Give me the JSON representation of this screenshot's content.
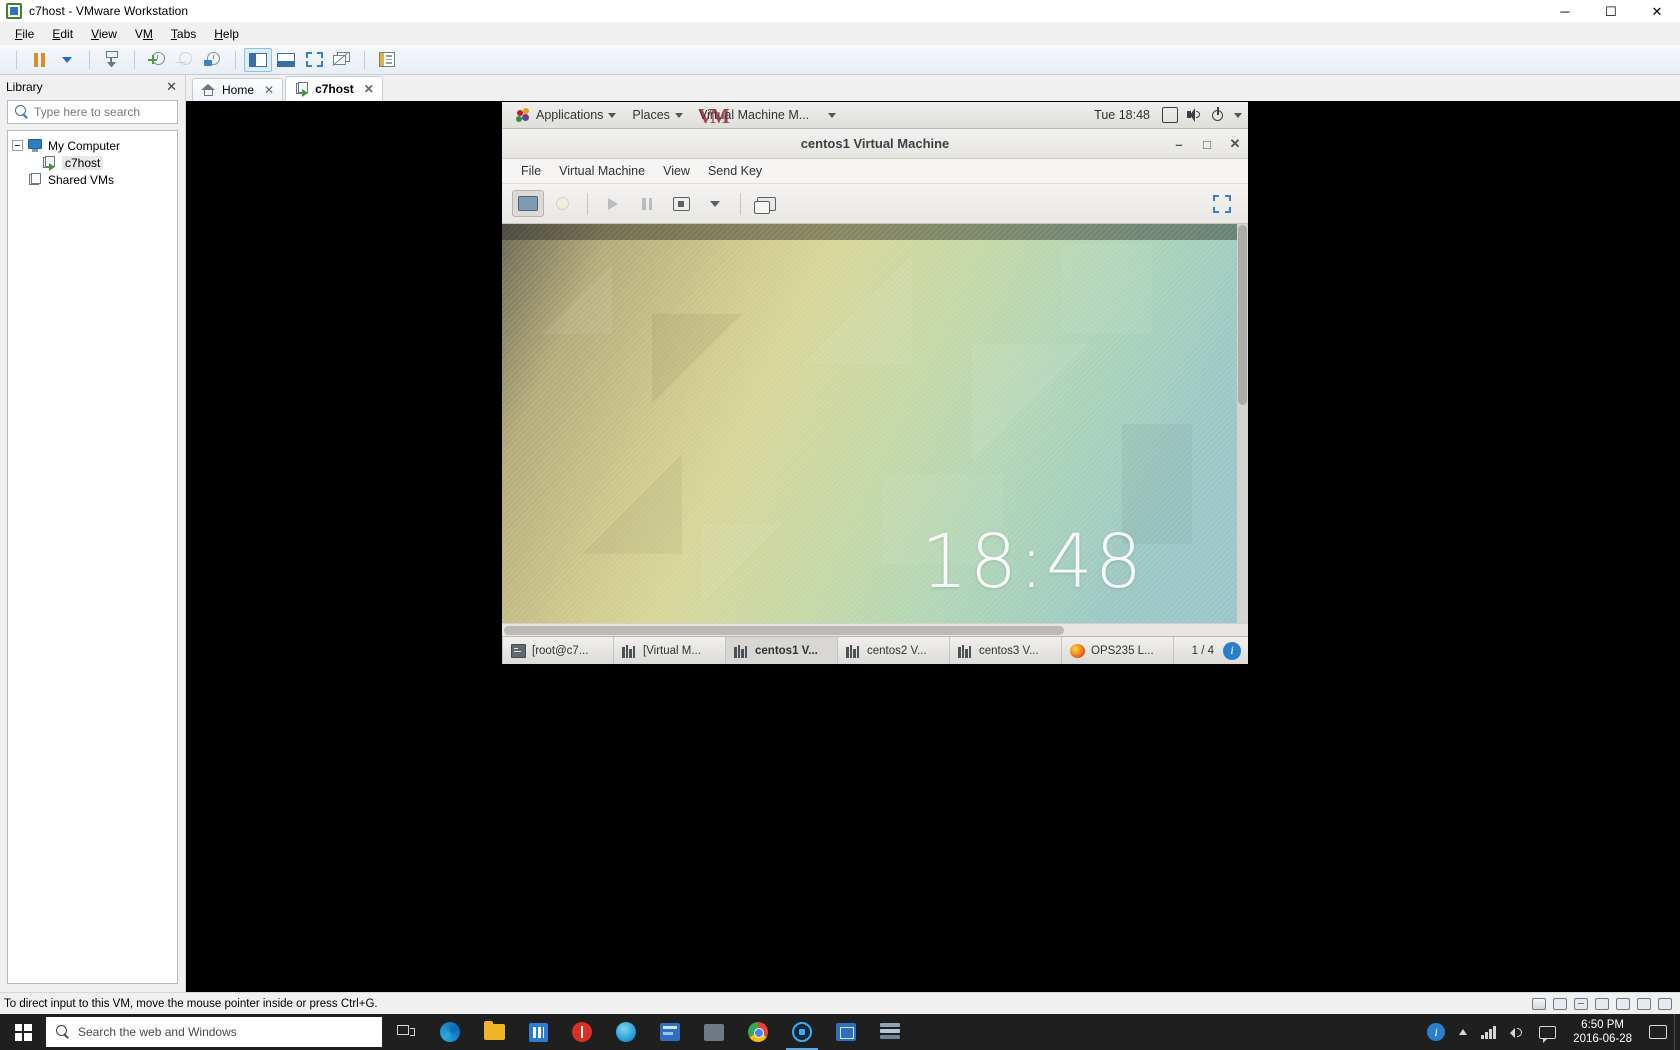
{
  "window": {
    "title": "c7host - VMware Workstation",
    "app_icon": "vmware-icon",
    "minimize": "─",
    "maximize": "☐",
    "close": "✕"
  },
  "menubar": [
    {
      "label": "File",
      "accel": "F"
    },
    {
      "label": "Edit",
      "accel": "E"
    },
    {
      "label": "View",
      "accel": "V"
    },
    {
      "label": "VM",
      "accel": "V"
    },
    {
      "label": "Tabs",
      "accel": "T"
    },
    {
      "label": "Help",
      "accel": "H"
    }
  ],
  "toolbar": {
    "buttons": [
      {
        "name": "suspend-button",
        "icon": "pause-icon"
      },
      {
        "name": "power-dropdown-button",
        "icon": "chevron-down-icon"
      },
      {
        "name": "manage-snapshots-button",
        "icon": "snapshot-manager-icon"
      },
      {
        "name": "take-snapshot-button",
        "icon": "snapshot-add-icon"
      },
      {
        "name": "revert-snapshot-button",
        "icon": "snapshot-revert-icon"
      },
      {
        "name": "snapshot-manager-button",
        "icon": "snapshot-settings-icon"
      },
      {
        "name": "show-library-button",
        "icon": "sidebar-icon"
      },
      {
        "name": "show-thumbnail-bar-button",
        "icon": "thumbnail-bar-icon"
      },
      {
        "name": "enter-fullscreen-button",
        "icon": "fullscreen-icon"
      },
      {
        "name": "unity-mode-button",
        "icon": "unity-icon"
      },
      {
        "name": "show-console-view-button",
        "icon": "console-view-icon"
      }
    ]
  },
  "library": {
    "title": "Library",
    "close_label": "✕",
    "search_placeholder": "Type here to search",
    "search_value": "",
    "tree": [
      {
        "label": "My Computer",
        "icon": "monitor-icon",
        "level": 0,
        "expanded": true,
        "selected": false
      },
      {
        "label": "c7host",
        "icon": "virtual-machine-icon",
        "level": 1,
        "expanded": false,
        "selected": true
      },
      {
        "label": "Shared VMs",
        "icon": "shared-vms-icon",
        "level": 0,
        "expanded": false,
        "selected": false
      }
    ]
  },
  "tabs": [
    {
      "label": "Home",
      "icon": "home-icon",
      "active": false,
      "close": "✕"
    },
    {
      "label": "c7host",
      "icon": "virtual-machine-icon",
      "active": true,
      "close": "✕"
    }
  ],
  "guest": {
    "gnome_panel": {
      "applications": "Applications",
      "places": "Places",
      "active_app": "Virtual Machine M...",
      "clock": "Tue 18:48",
      "tray": [
        "display-icon",
        "volume-icon",
        "power-icon",
        "chevron-down-icon"
      ],
      "overlay_logo": "VM"
    },
    "virt_manager": {
      "window_title": "centos1 Virtual Machine",
      "window_buttons": {
        "minimize": "–",
        "maximize": "□",
        "close": "✕"
      },
      "menus": [
        "File",
        "Virtual Machine",
        "View",
        "Send Key"
      ],
      "toolbar": [
        {
          "name": "show-console-button",
          "icon": "console-icon",
          "state": "active"
        },
        {
          "name": "show-details-button",
          "icon": "lightbulb-icon",
          "state": "dim"
        },
        {
          "name": "run-button",
          "icon": "play-icon",
          "state": "dim"
        },
        {
          "name": "pause-button",
          "icon": "pause-icon",
          "state": "dim"
        },
        {
          "name": "shutdown-button",
          "icon": "stop-icon",
          "state": "normal"
        },
        {
          "name": "shutdown-dropdown-button",
          "icon": "chevron-down-icon",
          "state": "normal"
        },
        {
          "name": "snapshots-button",
          "icon": "snapshots-icon",
          "state": "normal"
        },
        {
          "name": "fullscreen-button",
          "icon": "fullscreen-icon",
          "state": "normal"
        }
      ]
    },
    "desktop": {
      "clock": "18:48"
    },
    "taskbar": {
      "items": [
        {
          "label": "[root@c7...",
          "icon": "terminal-icon",
          "active": false
        },
        {
          "label": "[Virtual M...",
          "icon": "virt-manager-icon",
          "active": false
        },
        {
          "label": "centos1 V...",
          "icon": "virt-manager-icon",
          "active": true
        },
        {
          "label": "centos2 V...",
          "icon": "virt-manager-icon",
          "active": false
        },
        {
          "label": "centos3 V...",
          "icon": "virt-manager-icon",
          "active": false
        },
        {
          "label": "OPS235 L...",
          "icon": "firefox-icon",
          "active": false
        }
      ],
      "workspace": "1 / 4",
      "info_icon": "info-icon"
    }
  },
  "statusbar": {
    "message": "To direct input to this VM, move the mouse pointer inside or press Ctrl+G.",
    "device_icons": [
      "hard-disk-icon",
      "cd-drive-icon",
      "network-icon",
      "sound-icon",
      "usb-icon",
      "printer-icon",
      "display-icon"
    ]
  },
  "windows_taskbar": {
    "start_label": "Start",
    "search_placeholder": "Search the web and Windows",
    "task_view": "task-view-icon",
    "pinned": [
      {
        "name": "edge-icon"
      },
      {
        "name": "file-explorer-icon"
      },
      {
        "name": "microsoft-store-icon"
      },
      {
        "name": "opera-icon"
      },
      {
        "name": "teal-app-icon"
      },
      {
        "name": "blue-app-icon"
      },
      {
        "name": "gray-app-icon"
      },
      {
        "name": "chrome-icon"
      },
      {
        "name": "vmware-workstation-icon"
      },
      {
        "name": "vmware-player-icon"
      },
      {
        "name": "stack-app-icon"
      }
    ],
    "tray": {
      "chevron": "show-hidden-icons",
      "icons": [
        "info-icon",
        "network-icon",
        "volume-icon",
        "chat-icon"
      ],
      "time": "6:50 PM",
      "date": "2016-06-28",
      "action_center": "action-center-icon"
    }
  }
}
